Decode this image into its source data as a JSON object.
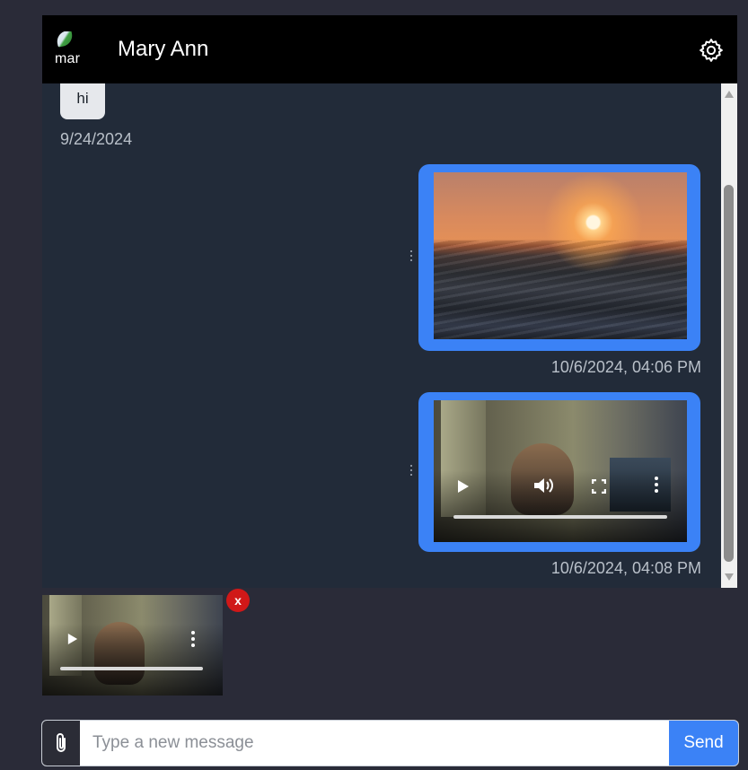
{
  "header": {
    "avatar_alt": "mar",
    "contact_name": "Mary Ann",
    "settings_icon": "gear-icon"
  },
  "messages": [
    {
      "direction": "incoming",
      "type": "text",
      "text": "hi",
      "timestamp": "9/24/2024"
    },
    {
      "direction": "outgoing",
      "type": "image",
      "timestamp": "10/6/2024, 04:06 PM"
    },
    {
      "direction": "outgoing",
      "type": "video",
      "timestamp": "10/6/2024, 04:08 PM"
    }
  ],
  "pending_attachment": {
    "type": "video",
    "remove_label": "x"
  },
  "composer": {
    "placeholder": "Type a new message",
    "value": "",
    "attach_icon": "paperclip-icon",
    "send_label": "Send"
  },
  "colors": {
    "accent": "#3b82f6",
    "header_bg": "#000000",
    "chat_bg": "#222b39",
    "remove_badge": "#d01818"
  }
}
